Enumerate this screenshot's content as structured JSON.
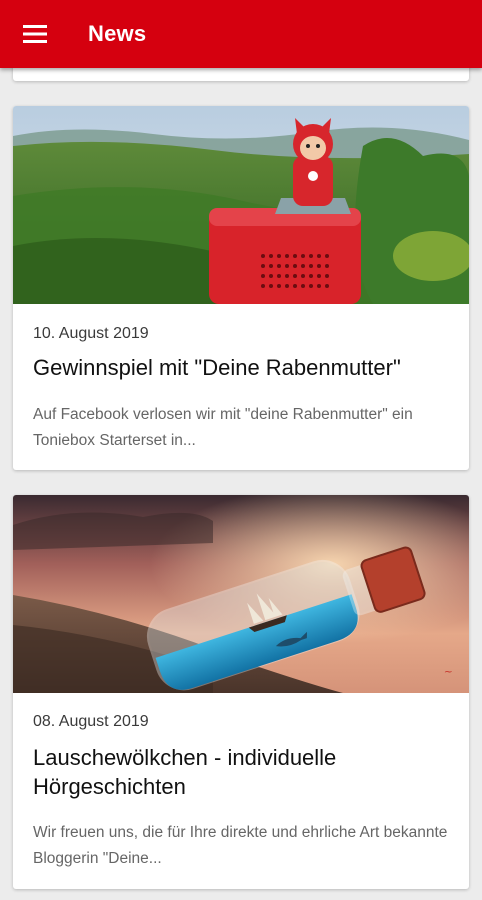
{
  "appbar": {
    "title": "News",
    "menu_icon": "hamburger-menu-icon",
    "color": "#d5000f"
  },
  "articles": [
    {
      "date": "10. August 2019",
      "title": "Gewinnspiel mit \"Deine Rabenmutter\"",
      "excerpt": "Auf Facebook verlosen wir mit \"deine Rabenmutter\" ein Toniebox Starterset in..."
    },
    {
      "date": "08. August 2019",
      "title": "Lauschewölkchen - individuelle Hörgeschichten",
      "excerpt": "Wir freuen uns, die für Ihre direkte und ehrliche Art bekannte Bloggerin \"Deine..."
    }
  ]
}
